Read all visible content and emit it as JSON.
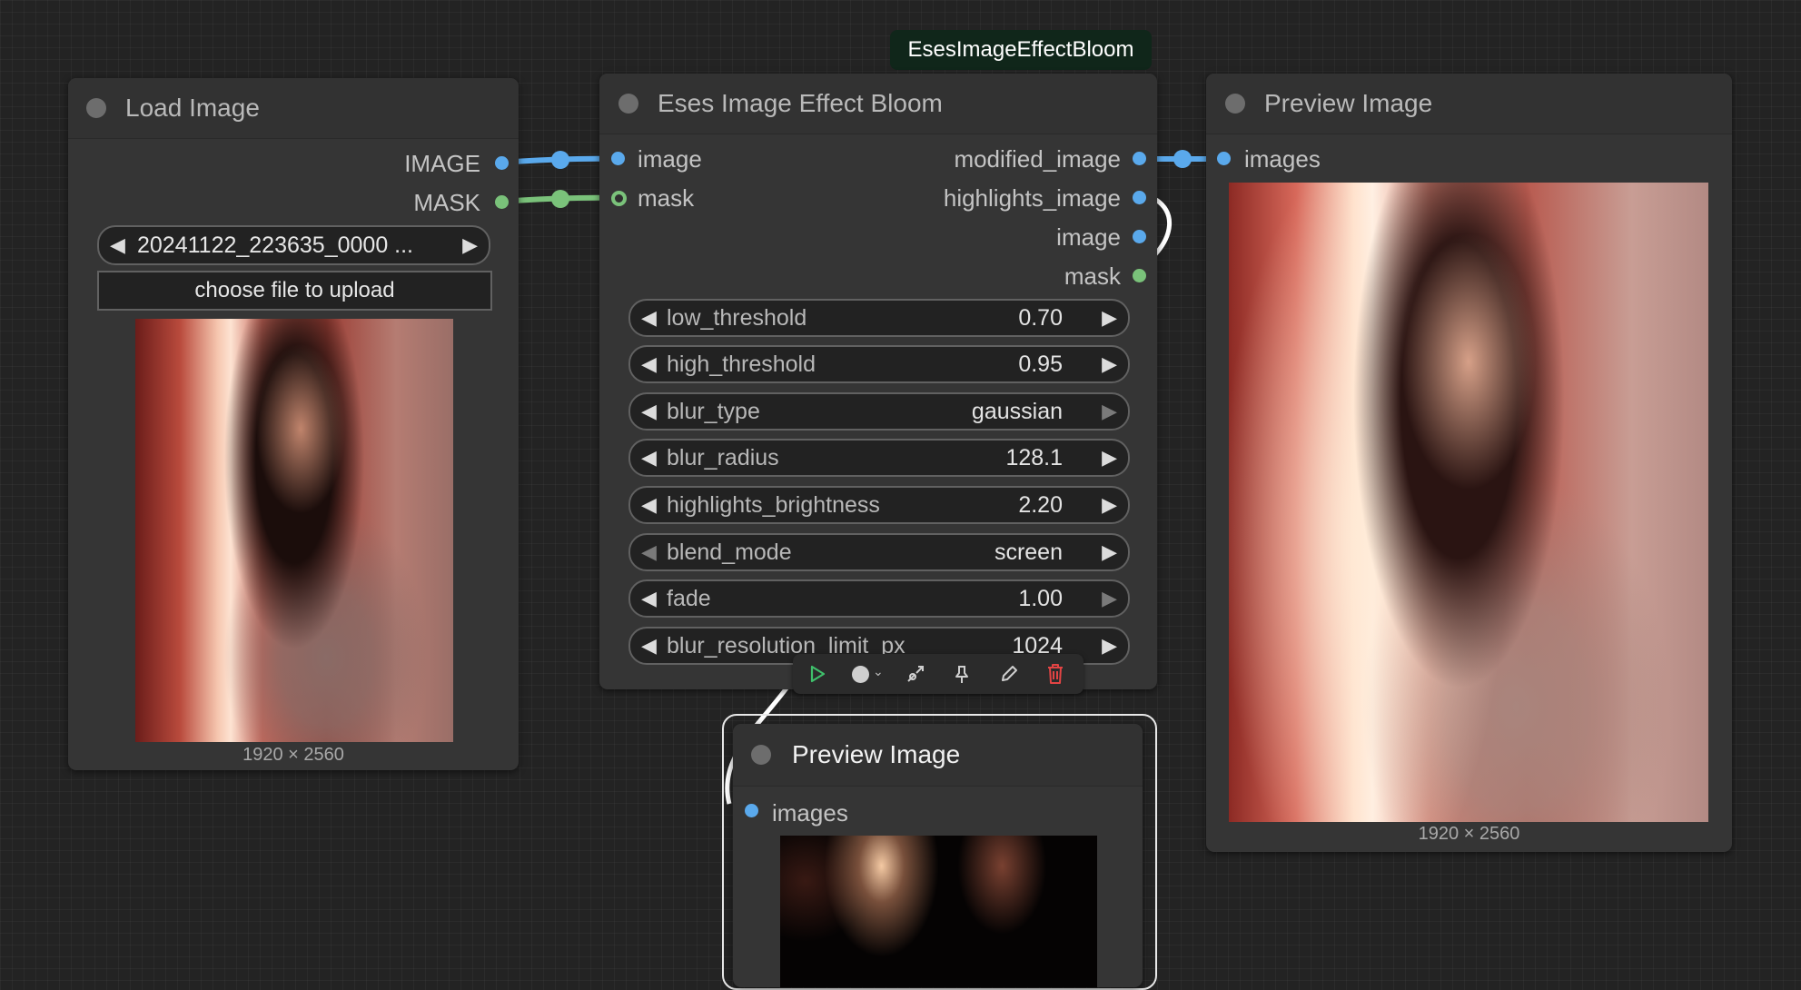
{
  "tooltip": {
    "text": "EsesImageEffectBloom"
  },
  "load_image_node": {
    "title": "Load Image",
    "outputs": [
      "IMAGE",
      "MASK"
    ],
    "file_value": "20241122_223635_0000 ...",
    "upload_label": "choose file to upload",
    "image_size": "1920 × 2560"
  },
  "bloom_node": {
    "title": "Eses Image Effect Bloom",
    "inputs": [
      "image",
      "mask"
    ],
    "outputs": [
      "modified_image",
      "highlights_image",
      "image",
      "mask"
    ],
    "widgets": [
      {
        "name": "low_threshold",
        "value": "0.70"
      },
      {
        "name": "high_threshold",
        "value": "0.95"
      },
      {
        "name": "blur_type",
        "value": "gaussian"
      },
      {
        "name": "blur_radius",
        "value": "128.1"
      },
      {
        "name": "highlights_brightness",
        "value": "2.20"
      },
      {
        "name": "blend_mode",
        "value": "screen"
      },
      {
        "name": "fade",
        "value": "1.00"
      },
      {
        "name": "blur_resolution_limit_px",
        "value": "1024"
      }
    ]
  },
  "toolbar": {
    "icons": [
      "play-icon",
      "color-circle-icon",
      "bypass-icon",
      "pin-icon",
      "edit-icon",
      "trash-icon"
    ]
  },
  "preview_node_right": {
    "title": "Preview Image",
    "input": "images",
    "image_size": "1920 × 2560"
  },
  "preview_node_bottom": {
    "title": "Preview Image",
    "input": "images"
  },
  "colors": {
    "image_link": "#5aa9ec",
    "mask_link": "#7ac27a",
    "delete": "#e24444",
    "run": "#3fbf6b",
    "tooltip_bg": "#10261a"
  }
}
